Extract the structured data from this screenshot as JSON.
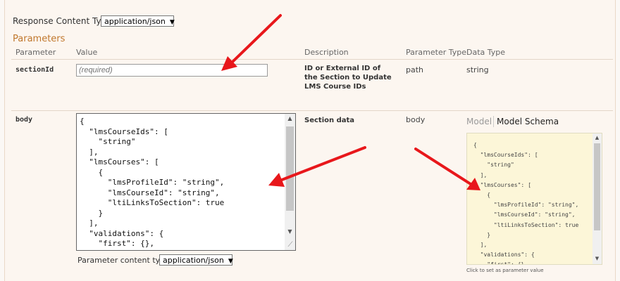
{
  "response_content_type": {
    "label": "Response Content Type",
    "selected": "application/json"
  },
  "parameters": {
    "title": "Parameters",
    "headers": {
      "parameter": "Parameter",
      "value": "Value",
      "description": "Description",
      "parameter_type": "Parameter Type",
      "data_type": "Data Type"
    },
    "rows": [
      {
        "name": "sectionId",
        "placeholder": "(required)",
        "description": "ID or External ID of the Section to Update LMS Course IDs",
        "param_type": "path",
        "data_type": "string"
      },
      {
        "name": "body",
        "value_json": "{\n  \"lmsCourseIds\": [\n    \"string\"\n  ],\n  \"lmsCourses\": [\n    {\n      \"lmsProfileId\": \"string\",\n      \"lmsCourseId\": \"string\",\n      \"ltiLinksToSection\": true\n    }\n  ],\n  \"validations\": {\n    \"first\": {},\n    \"rest\": {}",
        "description": "Section data",
        "param_type": "body",
        "content_type_label": "Parameter content type:",
        "content_type_selected": "application/json",
        "model_tab": "Model",
        "model_schema_tab": "Model Schema",
        "schema_json": "{\n  \"lmsCourseIds\": [\n    \"string\"\n  ],\n  \"lmsCourses\": [\n    {\n      \"lmsProfileId\": \"string\",\n      \"lmsCourseId\": \"string\",\n      \"ltiLinksToSection\": true\n    }\n  ],\n  \"validations\": {\n    \"first\": {},",
        "click_hint": "Click to set as parameter value"
      }
    ]
  },
  "colors": {
    "accent": "#c0772c",
    "annotation_arrow": "#e8171b",
    "schema_bg": "#fcf6d8"
  },
  "icons": {
    "dropdown": "caret-down-icon",
    "annotation": "red-arrow"
  }
}
